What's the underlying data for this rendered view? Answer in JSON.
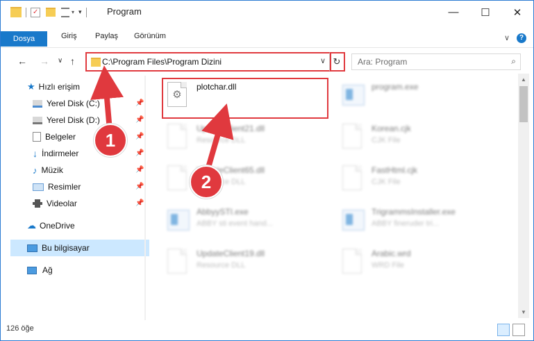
{
  "window": {
    "title": "Program",
    "minimize_label": "—",
    "maximize_label": "☐",
    "close_label": "✕"
  },
  "ribbon": {
    "tabs": [
      {
        "label": "Dosya"
      },
      {
        "label": "Giriş"
      },
      {
        "label": "Paylaş"
      },
      {
        "label": "Görünüm"
      }
    ],
    "help_label": "?",
    "collapse_label": "∨"
  },
  "nav": {
    "back_label": "←",
    "forward_label": "→",
    "recent_label": "∨",
    "up_label": "↑",
    "address": "C:\\Program Files\\Program Dizini",
    "dropdown_label": "∨",
    "refresh_label": "↻",
    "search_placeholder": "Ara: Program",
    "search_icon_label": "⌕"
  },
  "sidebar": {
    "items": [
      {
        "label": "Hızlı erişim",
        "icon": "star-icon"
      },
      {
        "label": "Yerel Disk (C:)",
        "icon": "drive-icon"
      },
      {
        "label": "Yerel Disk (D:)",
        "icon": "drive-icon"
      },
      {
        "label": "Belgeler",
        "icon": "documents-icon"
      },
      {
        "label": "İndirmeler",
        "icon": "download-icon"
      },
      {
        "label": "Müzik",
        "icon": "music-icon"
      },
      {
        "label": "Resimler",
        "icon": "pictures-icon"
      },
      {
        "label": "Videolar",
        "icon": "video-icon"
      },
      {
        "label": "OneDrive",
        "icon": "cloud-icon"
      },
      {
        "label": "Bu bilgisayar",
        "icon": "computer-icon"
      },
      {
        "label": "Ağ",
        "icon": "network-icon"
      }
    ],
    "pin_label": "📌"
  },
  "files": [
    {
      "name": "plotchar.dll",
      "desc": ""
    },
    {
      "name": "program.exe",
      "desc": ""
    },
    {
      "name": "UpdateClient21.dll",
      "desc": "Resource DLL"
    },
    {
      "name": "Korean.cjk",
      "desc": "CJK File"
    },
    {
      "name": "UpdateClient65.dll",
      "desc": "Resource DLL"
    },
    {
      "name": "FastHtml.cjk",
      "desc": "CJK File"
    },
    {
      "name": "AbbyySTI.exe",
      "desc": "ABBY sti event hand..."
    },
    {
      "name": "TrigrammsInstaller.exe",
      "desc": "ABBY fineruder tri..."
    },
    {
      "name": "UpdateClient19.dll",
      "desc": "Resource DLL"
    },
    {
      "name": "Arabic.wrd",
      "desc": "WRD File"
    }
  ],
  "status": {
    "count": "126 öğe"
  },
  "callouts": {
    "one": "1",
    "two": "2"
  },
  "colors": {
    "accent": "#1979ca",
    "highlight_red": "#e0393e",
    "selection": "#cce8ff"
  }
}
